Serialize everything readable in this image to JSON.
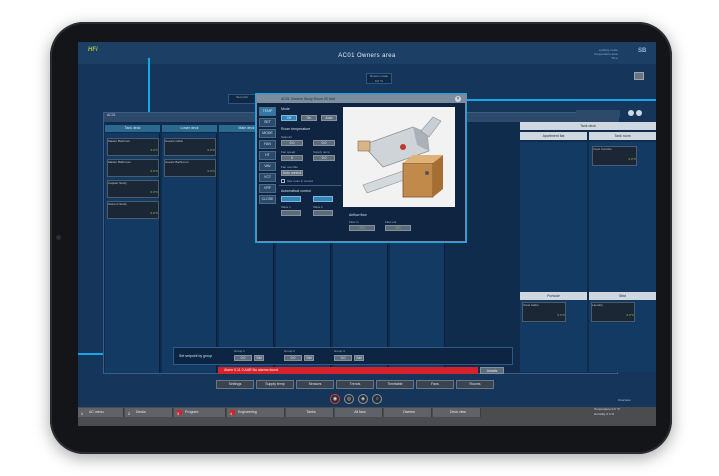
{
  "app": {
    "title": "AC01 Owners area",
    "logo": "HFi",
    "brand_right": "SB",
    "status_lines": [
      "Lighting mode",
      "Temperature area",
      "Time"
    ],
    "colors": {
      "accent": "#16a8e6",
      "screen_bg": "#16355a",
      "alarm": "#d6222b",
      "ok_green": "#8bc34a"
    }
  },
  "chips": {
    "rooms_mode": "Rooms mode",
    "setpoint": "Set point",
    "setpoint_value": "0.0 °C"
  },
  "main_window": {
    "title": "AC01",
    "tabs": [
      "Tank deck",
      "Lower deck",
      "Main deck"
    ],
    "tiles": [
      {
        "name": "Master Bedroom",
        "value": "0.0°C"
      },
      {
        "name": "Master Bathroom",
        "value": "0.0°C"
      },
      {
        "name": "Captain Study",
        "value": "0.0°C"
      },
      {
        "name": "Owners Study",
        "value": "0.0°C"
      },
      {
        "name": "Guests Cabin",
        "value": "0.0°C"
      },
      {
        "name": "Guests Bathroom",
        "value": "0.0°C"
      }
    ]
  },
  "popup": {
    "title": "AC01 Owners Study Room 00 Unit",
    "side_buttons": [
      "TEMP",
      "SET",
      "MODE",
      "FAN",
      "HT",
      "VAV",
      "VCT",
      "VRF",
      "CLOSE"
    ],
    "mode_label": "Mode",
    "mode_buttons": [
      "Off",
      "On",
      "Auto"
    ],
    "room_temp_label": "Room temperature",
    "setpoint_label": "Setpoint",
    "room_temp_value": "0.0",
    "setpoint_value": "0.0",
    "fan_speed_label": "Fan speed",
    "fan_speed_value": "0",
    "supply_label": "Supply temp",
    "supply_value": "0.0",
    "fan_override_label": "Fan override",
    "auto_control_label": "Auto control",
    "checkbox_label": "Use room in control",
    "auto_title": "Automatical control",
    "valve1": "Valve 1",
    "valve2": "Valve 2",
    "airflow_title": "Airflow flow",
    "flow_in": "Flow in",
    "flow_out": "Flow out",
    "flow_in_value": "0.0",
    "flow_out_value": "0.0"
  },
  "right_panel": {
    "tabs": [
      "Tank deck",
      "Tank deck 2"
    ],
    "header_left": "Apartment flat",
    "header_right": "Tank room",
    "tile_top": {
      "name": "Crew Corridor",
      "value": "0.0°C"
    },
    "lower_tabs": [
      "Portside",
      "Stbd"
    ],
    "tile_left": {
      "name": "Crew Cabin",
      "value": "0.0°C"
    },
    "tile_right": {
      "name": "Laundry",
      "value": "0.0°C"
    }
  },
  "setpoint_bar": {
    "label": "Set setpoint by group",
    "groups": [
      {
        "label": "Group 1",
        "value": "0.0"
      },
      {
        "label": "Group 2",
        "value": "0.0"
      },
      {
        "label": "Group 3",
        "value": "0.0"
      }
    ],
    "set_label": "Set"
  },
  "alarm": {
    "text": "Alarm  0.11  0  AAR  No alarms found",
    "button": "Details"
  },
  "menu": [
    "Settings",
    "Supply temp",
    "Sensors",
    "Trends",
    "Timetable",
    "Fans",
    "Rooms"
  ],
  "controls": [
    "◉",
    "◎",
    "◈",
    "○"
  ],
  "nav": [
    {
      "num": "1",
      "label": "AC menu",
      "color": "#5f6268"
    },
    {
      "num": "2",
      "label": "Decks",
      "color": "#5f6268"
    },
    {
      "num": "3",
      "label": "Program",
      "color": "#d6222b"
    },
    {
      "num": "4",
      "label": "Engineering",
      "color": "#d6222b"
    },
    {
      "num": "",
      "label": "Tanks",
      "color": "#5f6268"
    },
    {
      "num": "",
      "label": "All fans",
      "color": "#5f6268"
    },
    {
      "num": "",
      "label": "Owners",
      "color": "#5f6268"
    },
    {
      "num": "",
      "label": "Deck view",
      "color": "#5f6268"
    }
  ],
  "bottom_right": {
    "caption": "Overview",
    "line1": "Temperature  0.0 °C",
    "line2": "Humidity  0.0 %"
  }
}
